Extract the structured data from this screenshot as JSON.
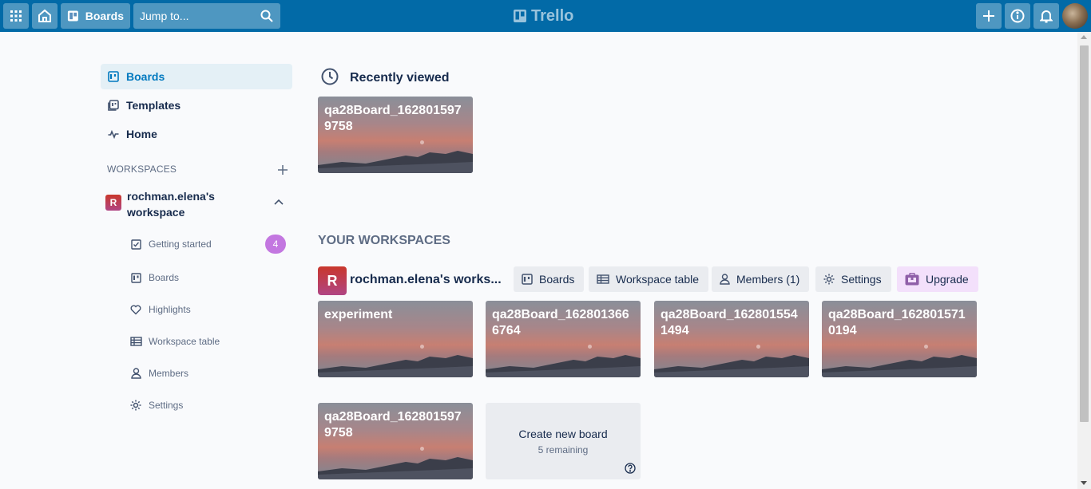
{
  "header": {
    "apps_icon": "grid-icon",
    "home_icon": "home-icon",
    "boards_label": "Boards",
    "search_placeholder": "Jump to...",
    "logo_text": "Trello",
    "create_icon": "plus-icon",
    "info_icon": "info-icon",
    "notifications_icon": "bell-icon"
  },
  "sidebar": {
    "items": [
      {
        "label": "Boards",
        "icon": "board-icon",
        "active": true
      },
      {
        "label": "Templates",
        "icon": "template-icon"
      },
      {
        "label": "Home",
        "icon": "activity-icon"
      }
    ],
    "workspaces_label": "WORKSPACES",
    "workspace": {
      "badge": "R",
      "name": "rochman.elena's workspace"
    },
    "sub_items": [
      {
        "label": "Getting started",
        "icon": "checkbox-icon",
        "count": "4"
      },
      {
        "label": "Boards",
        "icon": "board-icon"
      },
      {
        "label": "Highlights",
        "icon": "heart-icon"
      },
      {
        "label": "Workspace table",
        "icon": "table-icon"
      },
      {
        "label": "Members",
        "icon": "person-icon"
      },
      {
        "label": "Settings",
        "icon": "gear-icon"
      }
    ]
  },
  "main": {
    "recently_viewed_title": "Recently viewed",
    "recent_boards": [
      "qa28Board_1628015979758"
    ],
    "your_workspaces_title": "YOUR WORKSPACES",
    "workspace": {
      "badge": "R",
      "name": "rochman.elena's works...",
      "tabs": [
        {
          "label": "Boards",
          "icon": "board-icon"
        },
        {
          "label": "Workspace table",
          "icon": "table-icon"
        },
        {
          "label": "Members (1)",
          "icon": "person-icon"
        },
        {
          "label": "Settings",
          "icon": "gear-icon"
        },
        {
          "label": "Upgrade",
          "icon": "briefcase-icon"
        }
      ]
    },
    "boards": [
      "experiment",
      "qa28Board_1628013666764",
      "qa28Board_1628015541494",
      "qa28Board_1628015710194",
      "qa28Board_1628015979758"
    ],
    "create": {
      "title": "Create new board",
      "subtitle": "5 remaining"
    }
  },
  "colors": {
    "header": "#026aa7",
    "active_bg": "#e4f0f6",
    "accent": "#0079bf",
    "count_badge": "#c377e0",
    "upgrade_bg": "#f3e0fb"
  }
}
